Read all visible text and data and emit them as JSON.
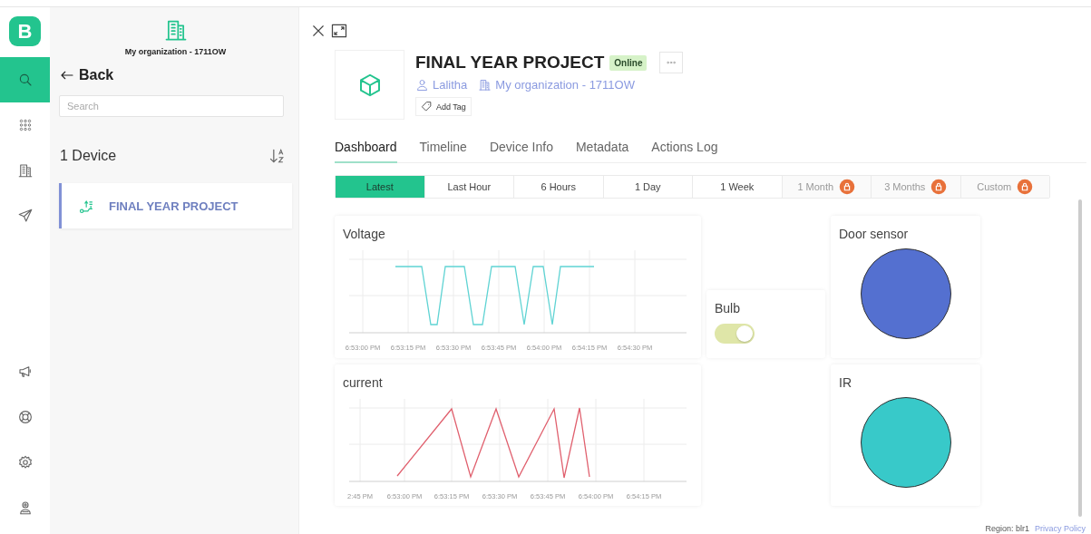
{
  "rail": {
    "logo": "B",
    "items": [
      {
        "kind": "search",
        "selected": true
      },
      {
        "kind": "apps",
        "selected": false
      },
      {
        "kind": "building",
        "selected": false
      },
      {
        "kind": "send",
        "selected": false
      },
      {
        "kind": "megaphone",
        "selected": false
      },
      {
        "kind": "help",
        "selected": false
      },
      {
        "kind": "settings",
        "selected": false
      },
      {
        "kind": "user",
        "selected": false
      }
    ]
  },
  "panel": {
    "organization": "My organization - 1711OW",
    "back": "Back",
    "search": {
      "placeholder": "Search"
    },
    "device_count": "1 Device",
    "devices": [
      {
        "name": "FINAL YEAR PROJECT",
        "selected": true
      }
    ]
  },
  "device": {
    "title": "FINAL YEAR PROJECT",
    "status": "Online",
    "owner": "Lalitha",
    "organization": "My organization - 1711OW",
    "add_tag": "Add Tag"
  },
  "tabs": [
    {
      "label": "Dashboard",
      "selected": true
    },
    {
      "label": "Timeline",
      "selected": false
    },
    {
      "label": "Device Info",
      "selected": false
    },
    {
      "label": "Metadata",
      "selected": false
    },
    {
      "label": "Actions Log",
      "selected": false
    }
  ],
  "time_ranges": [
    {
      "label": "Latest",
      "selected": true,
      "locked": false
    },
    {
      "label": "Last Hour",
      "selected": false,
      "locked": false
    },
    {
      "label": "6 Hours",
      "selected": false,
      "locked": false
    },
    {
      "label": "1 Day",
      "selected": false,
      "locked": false
    },
    {
      "label": "1 Week",
      "selected": false,
      "locked": false
    },
    {
      "label": "1 Month",
      "selected": false,
      "locked": true
    },
    {
      "label": "3 Months",
      "selected": false,
      "locked": true
    },
    {
      "label": "Custom",
      "selected": false,
      "locked": true
    }
  ],
  "widgets": [
    {
      "kind": "chart",
      "title": "Voltage",
      "color": "#5fd3d3",
      "x_labels": [
        "6:53:00 PM",
        "6:53:15 PM",
        "6:53:30 PM",
        "6:53:45 PM",
        "6:54:00 PM",
        "6:54:15 PM",
        "6:54:30 PM"
      ]
    },
    {
      "kind": "switch",
      "title": "Bulb",
      "on": true
    },
    {
      "kind": "led",
      "title": "Door sensor",
      "color": "#5470d0"
    },
    {
      "kind": "chart",
      "title": "current",
      "color": "#e0606e",
      "x_labels": [
        "2:45 PM",
        "6:53:00 PM",
        "6:53:15 PM",
        "6:53:30 PM",
        "6:53:45 PM",
        "6:54:00 PM",
        "6:54:15 PM"
      ]
    },
    {
      "kind": "led",
      "title": "IR",
      "color": "#38c9c9"
    }
  ],
  "footer": {
    "region": "Region: blr1",
    "privacy": "Privacy Policy"
  }
}
